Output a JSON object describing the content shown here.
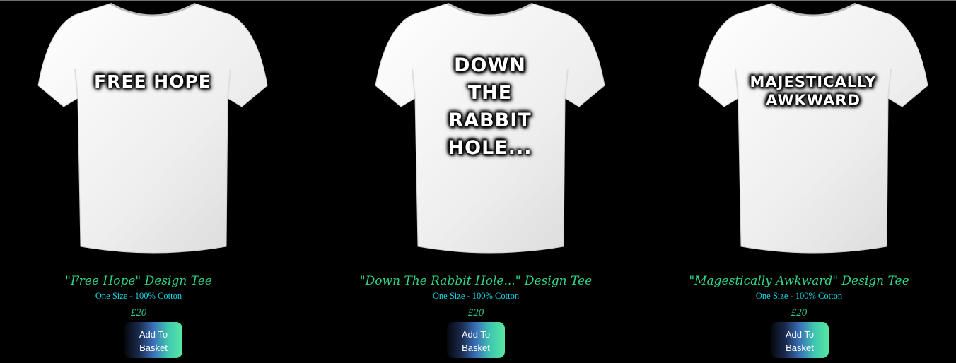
{
  "products": [
    {
      "shirt_print": "FREE HOPE",
      "title": "\"Free Hope\" Design Tee",
      "subtitle": "One Size - 100% Cotton",
      "price": "£20",
      "button_label": "Add To\nBasket"
    },
    {
      "shirt_print": "DOWN\nTHE\nRABBIT\nHOLE...",
      "title": "\"Down The Rabbit Hole...\" Design Tee",
      "subtitle": "One Size - 100% Cotton",
      "price": "£20",
      "button_label": "Add To\nBasket"
    },
    {
      "shirt_print": "MAJESTICALLY\nAWKWARD",
      "title": "\"Magestically Awkward\" Design Tee",
      "subtitle": "One Size - 100% Cotton",
      "price": "£20",
      "button_label": "Add To\nBasket"
    }
  ],
  "colors": {
    "background": "#000000",
    "title": "#2fd48a",
    "subtitle": "#19d3e6",
    "price": "#2fbf8a"
  }
}
